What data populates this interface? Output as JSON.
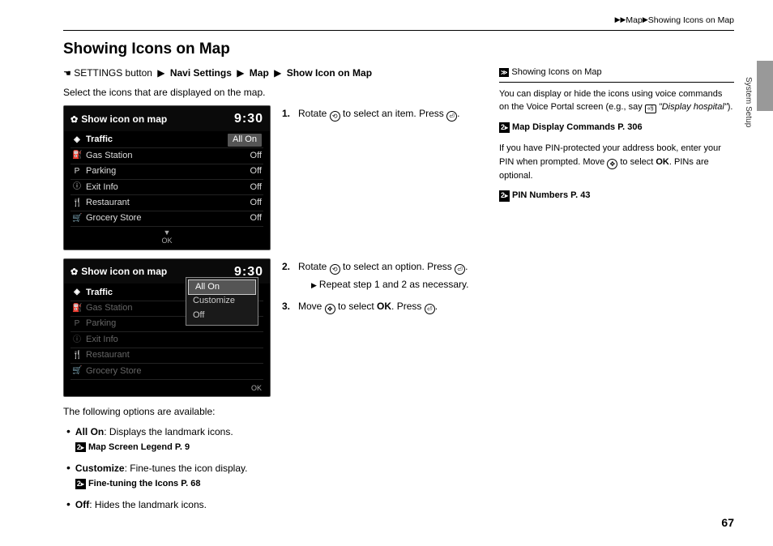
{
  "breadcrumb": {
    "a": "Map",
    "b": "Showing Icons on Map"
  },
  "title": "Showing Icons on Map",
  "navpath": {
    "pre": "SETTINGS button",
    "p1": "Navi Settings",
    "p2": "Map",
    "p3": "Show Icon on Map"
  },
  "intro": "Select the icons that are displayed on the map.",
  "shot1": {
    "head": "Show icon on map",
    "clock": "9:30",
    "items": [
      {
        "icon": "◈",
        "label": "Traffic",
        "val": "All On",
        "sel": true
      },
      {
        "icon": "⛽",
        "label": "Gas Station",
        "val": "Off"
      },
      {
        "icon": "P",
        "label": "Parking",
        "val": "Off"
      },
      {
        "icon": "ⓘ",
        "label": "Exit Info",
        "val": "Off"
      },
      {
        "icon": "🍴",
        "label": "Restaurant",
        "val": "Off"
      },
      {
        "icon": "🛒",
        "label": "Grocery Store",
        "val": "Off"
      }
    ],
    "ok": "OK"
  },
  "shot2": {
    "head": "Show icon on map",
    "clock": "9:30",
    "items": [
      {
        "icon": "◈",
        "label": "Traffic",
        "val": "",
        "sel": true
      },
      {
        "icon": "⛽",
        "label": "Gas Station",
        "val": ""
      },
      {
        "icon": "P",
        "label": "Parking",
        "val": ""
      },
      {
        "icon": "ⓘ",
        "label": "Exit Info",
        "val": ""
      },
      {
        "icon": "🍴",
        "label": "Restaurant",
        "val": ""
      },
      {
        "icon": "🛒",
        "label": "Grocery Store",
        "val": ""
      }
    ],
    "popup": [
      {
        "label": "All On",
        "sel": true
      },
      {
        "label": "Customize"
      },
      {
        "label": "Off"
      }
    ],
    "ok": "OK"
  },
  "steps": {
    "s1a": "Rotate ",
    "s1b": " to select an item. Press ",
    "s1c": ".",
    "s2a": "Rotate ",
    "s2b": " to select an option. Press ",
    "s2c": ".",
    "s2sub": "Repeat step 1 and 2 as necessary.",
    "s3a": "Move ",
    "s3b": " to select ",
    "s3ok": "OK",
    "s3c": ". Press ",
    "s3d": "."
  },
  "options_intro": "The following options are available:",
  "options": [
    {
      "name": "All On",
      "desc": ": Displays the landmark icons.",
      "xref": "Map Screen Legend",
      "xpage": "P. 9"
    },
    {
      "name": "Customize",
      "desc": ": Fine-tunes the icon display.",
      "xref": "Fine-tuning the Icons",
      "xpage": "P. 68"
    },
    {
      "name": "Off",
      "desc": ": Hides the landmark icons."
    }
  ],
  "side": {
    "head": "Showing Icons on Map",
    "p1a": "You can display or hide the icons using voice commands on the Voice Portal screen (e.g., say ",
    "p1b": "\"Display hospital\"",
    "p1c": ").",
    "x1": "Map Display Commands",
    "x1p": "P. 306",
    "p2a": "If you have PIN-protected your address book, enter your PIN when prompted. Move ",
    "p2b": " to select ",
    "p2ok": "OK",
    "p2c": ". PINs are optional.",
    "x2": "PIN Numbers",
    "x2p": "P. 43"
  },
  "side_label": "System Setup",
  "page_num": "67"
}
